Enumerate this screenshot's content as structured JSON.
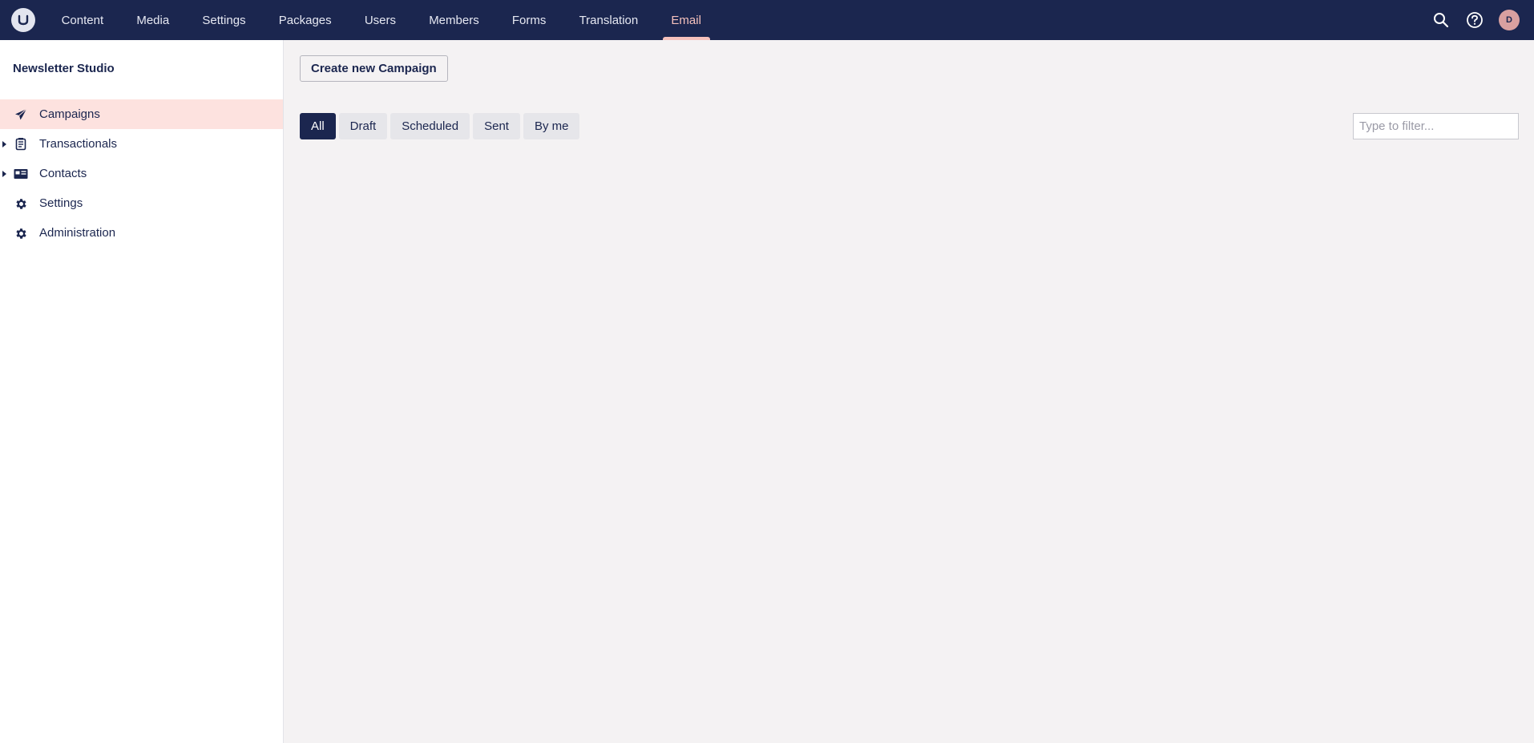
{
  "topbar": {
    "nav": [
      {
        "label": "Content"
      },
      {
        "label": "Media"
      },
      {
        "label": "Settings"
      },
      {
        "label": "Packages"
      },
      {
        "label": "Users"
      },
      {
        "label": "Members"
      },
      {
        "label": "Forms"
      },
      {
        "label": "Translation"
      },
      {
        "label": "Email",
        "active": true
      }
    ],
    "avatar_initial": "D"
  },
  "sidebar": {
    "title": "Newsletter Studio",
    "items": [
      {
        "label": "Campaigns",
        "icon": "paper-plane-icon",
        "active": true
      },
      {
        "label": "Transactionals",
        "icon": "document-icon",
        "expandable": true
      },
      {
        "label": "Contacts",
        "icon": "address-card-icon",
        "expandable": true
      },
      {
        "label": "Settings",
        "icon": "gear-icon"
      },
      {
        "label": "Administration",
        "icon": "gear-icon"
      }
    ]
  },
  "main": {
    "create_button": "Create new Campaign",
    "filters": [
      {
        "label": "All",
        "active": true
      },
      {
        "label": "Draft"
      },
      {
        "label": "Scheduled"
      },
      {
        "label": "Sent"
      },
      {
        "label": "By me"
      }
    ],
    "filter_placeholder": "Type to filter..."
  },
  "colors": {
    "header_bg": "#1b264f",
    "accent": "#f5c1bc",
    "active_row": "#fde2df",
    "main_bg": "#f4f2f3"
  }
}
